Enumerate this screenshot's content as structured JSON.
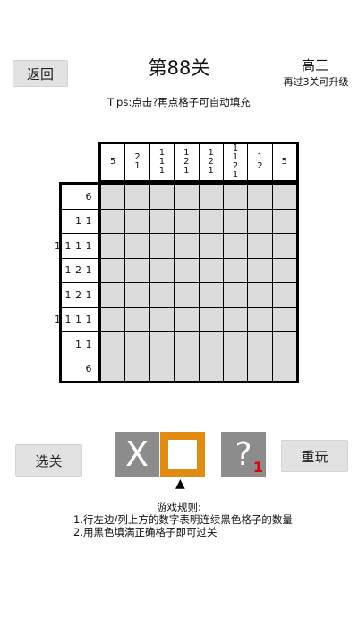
{
  "header": {
    "back_label": "返回",
    "level_title": "第88关",
    "grade": "高三",
    "upgrade_hint": "再过3关可升级"
  },
  "tips": "Tips:点击?再点格子可自动填充",
  "puzzle": {
    "size": 8,
    "col_clues": [
      [
        "5"
      ],
      [
        "2",
        "1"
      ],
      [
        "1",
        "1",
        "1"
      ],
      [
        "1",
        "2",
        "1"
      ],
      [
        "1",
        "2",
        "1"
      ],
      [
        "1",
        "1",
        "2",
        "1"
      ],
      [
        "1",
        "2"
      ],
      [
        "5"
      ]
    ],
    "row_clues": [
      "6",
      "1 1",
      "1 1 1 1",
      "1 2 1",
      "1 2 1",
      "1 1 1 1",
      "1 1",
      "6"
    ]
  },
  "tools": {
    "x_label": "X",
    "hint_label": "?",
    "hint_count": "1",
    "selected": "fill"
  },
  "buttons": {
    "select_level": "选关",
    "replay": "重玩"
  },
  "rules": {
    "title": "游戏规则:",
    "items": [
      "1.行左边/列上方的数字表明连续黑色格子的数量",
      "2.用黑色填满正确格子即可过关"
    ]
  }
}
